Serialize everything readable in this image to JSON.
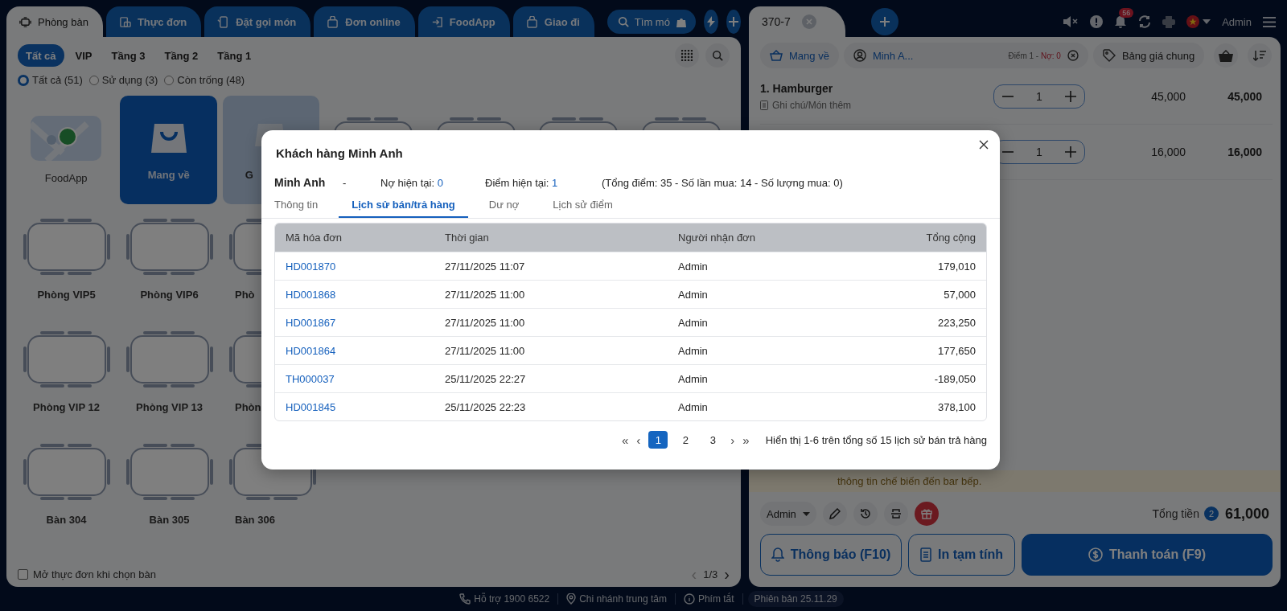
{
  "left_tabs": [
    {
      "label": "Phòng bàn",
      "selected": true
    },
    {
      "label": "Thực đơn",
      "selected": false
    },
    {
      "label": "Đặt gọi món",
      "selected": false
    },
    {
      "label": "Đơn online",
      "selected": false
    },
    {
      "label": "FoodApp",
      "selected": false
    },
    {
      "label": "Giao đi",
      "selected": false
    }
  ],
  "search": {
    "placeholder": "Tìm mó"
  },
  "floors": [
    {
      "label": "Tất cả",
      "selected": true
    },
    {
      "label": "VIP",
      "selected": false
    },
    {
      "label": "Tầng 3",
      "selected": false
    },
    {
      "label": "Tầng 2",
      "selected": false
    },
    {
      "label": "Tầng 1",
      "selected": false
    }
  ],
  "filters": [
    {
      "label": "Tất cả (51)",
      "selected": true
    },
    {
      "label": "Sử dụng (3)",
      "selected": false
    },
    {
      "label": "Còn trống (48)",
      "selected": false
    }
  ],
  "card_rows": [
    [
      {
        "kind": "foodapp",
        "label": "FoodApp",
        "selected": false
      },
      {
        "kind": "takeaway",
        "label": "Mang về",
        "selected": true
      },
      {
        "kind": "delivery",
        "label": "G",
        "selected": false
      },
      {
        "kind": "table",
        "selected": false
      },
      {
        "kind": "table",
        "selected": false
      },
      {
        "kind": "table",
        "selected": false
      },
      {
        "kind": "table",
        "selected": false
      }
    ],
    [
      {
        "kind": "table",
        "label": "Phòng VIP5",
        "selected": false
      },
      {
        "kind": "table",
        "label": "Phòng VIP6",
        "selected": false
      },
      {
        "kind": "table",
        "label": "Phò",
        "selected": false
      }
    ],
    [
      {
        "kind": "table",
        "label": "Phòng VIP 12",
        "selected": false
      },
      {
        "kind": "table",
        "label": "Phòng VIP 13",
        "selected": false
      },
      {
        "kind": "table",
        "label": "Phòn",
        "selected": false
      }
    ],
    [
      {
        "kind": "table",
        "label": "Bàn 304",
        "selected": false
      },
      {
        "kind": "table",
        "label": "Bàn 305",
        "selected": false
      },
      {
        "kind": "table",
        "label": "Bàn 306",
        "selected": false
      }
    ]
  ],
  "open_menu_option": {
    "label": "Mở thực đơn khi chọn bàn",
    "checked": false
  },
  "page_nav": {
    "previous": "‹",
    "indicator": "1/3",
    "next": "›"
  },
  "order_tabs": [
    {
      "label": "370-7",
      "selected": true
    }
  ],
  "header": {
    "notifications": "56",
    "user": "Admin"
  },
  "order_bar": {
    "service": "Mang về",
    "customer": "Minh A...",
    "points": "Điểm 1 - ",
    "debt": "Nợ: 0",
    "price_list": "Bảng giá chung"
  },
  "items": [
    {
      "name": "1. Hamburger",
      "note": "Ghi chú/Món thêm",
      "qty": "1",
      "price": "45,000",
      "total": "45,000"
    },
    {
      "qty": "1",
      "price": "16,000",
      "total": "16,000"
    }
  ],
  "notice": "thông tin chế biến đến bar bếp.",
  "staff": "Admin",
  "total": {
    "label": "Tổng tiền",
    "count": "2",
    "amount": "61,000"
  },
  "actions": [
    "Thông báo (F10)",
    "In tạm tính",
    "Thanh toán (F9)"
  ],
  "footer": [
    "Hỗ trợ 1900 6522",
    "Chi nhánh trung tâm",
    "Phím tắt",
    "Phiên bản 25.11.29"
  ],
  "modal": {
    "title": "Khách hàng Minh Anh",
    "customer": {
      "name": "Minh Anh",
      "separator": "-",
      "debt_label": "Nợ hiện tại:",
      "debt": "0",
      "points_label": "Điểm hiện tại:",
      "points": "1",
      "summary": "(Tổng điểm: 35  - Số lần mua: 14  - Số lượng mua: 0)"
    },
    "tabs": [
      {
        "label": "Thông tin",
        "selected": false
      },
      {
        "label": "Lịch sử bán/trả hàng",
        "selected": true
      },
      {
        "label": "Dư nợ",
        "selected": false
      },
      {
        "label": "Lịch sử điểm",
        "selected": false
      }
    ],
    "table": {
      "columns": [
        "Mã hóa đơn",
        "Thời gian",
        "Người nhận đơn",
        "Tổng cộng"
      ],
      "rows": [
        [
          "HD001870",
          "27/11/2025 11:07",
          "Admin",
          "179,010"
        ],
        [
          "HD001868",
          "27/11/2025 11:00",
          "Admin",
          "57,000"
        ],
        [
          "HD001867",
          "27/11/2025 11:00",
          "Admin",
          "223,250"
        ],
        [
          "HD001864",
          "27/11/2025 11:00",
          "Admin",
          "177,650"
        ],
        [
          "TH000037",
          "25/11/2025 22:27",
          "Admin",
          "-189,050"
        ],
        [
          "HD001845",
          "25/11/2025 22:23",
          "Admin",
          "378,100"
        ]
      ]
    },
    "pagination": {
      "first": "«",
      "previous": "‹",
      "next": "›",
      "last": "»",
      "pages": [
        {
          "label": "1",
          "selected": true
        },
        {
          "label": "2",
          "selected": false
        },
        {
          "label": "3",
          "selected": false
        }
      ],
      "info": "Hiển thị 1-6 trên tổng số 15 lịch sử bán trả hàng"
    }
  }
}
